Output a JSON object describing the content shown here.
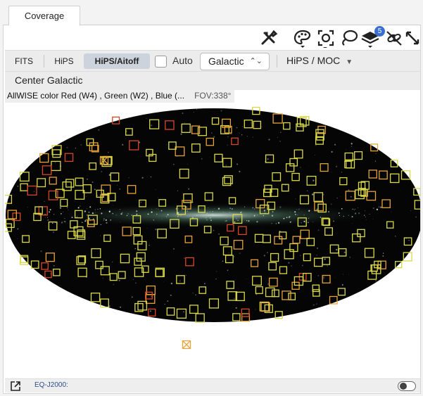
{
  "tabs": [
    {
      "label": "Coverage"
    }
  ],
  "toolbar": {
    "layers_badge": "5"
  },
  "view_buttons": {
    "fits": "FITS",
    "hips": "HiPS",
    "hips_aitoff": "HiPS/Aitoff"
  },
  "auto_checkbox": {
    "label": "Auto",
    "checked": false
  },
  "coord_select": {
    "value": "Galactic",
    "arrow": "⌃⌄"
  },
  "hips_moc_menu": {
    "label": "HiPS / MOC",
    "caret": "▼"
  },
  "center_button": "Center Galactic",
  "viewer": {
    "image_title": "AllWISE color Red (W4) , Green (W2) , Blue (...",
    "fov": "FOV:338°",
    "colors": {
      "sky": "#050505",
      "footprint_yellow": "#d8d84a",
      "footprint_orange": "#e6a33a",
      "footprint_red": "#d9462a"
    }
  },
  "status": {
    "coordinate_system": "EQ-J2000:"
  }
}
